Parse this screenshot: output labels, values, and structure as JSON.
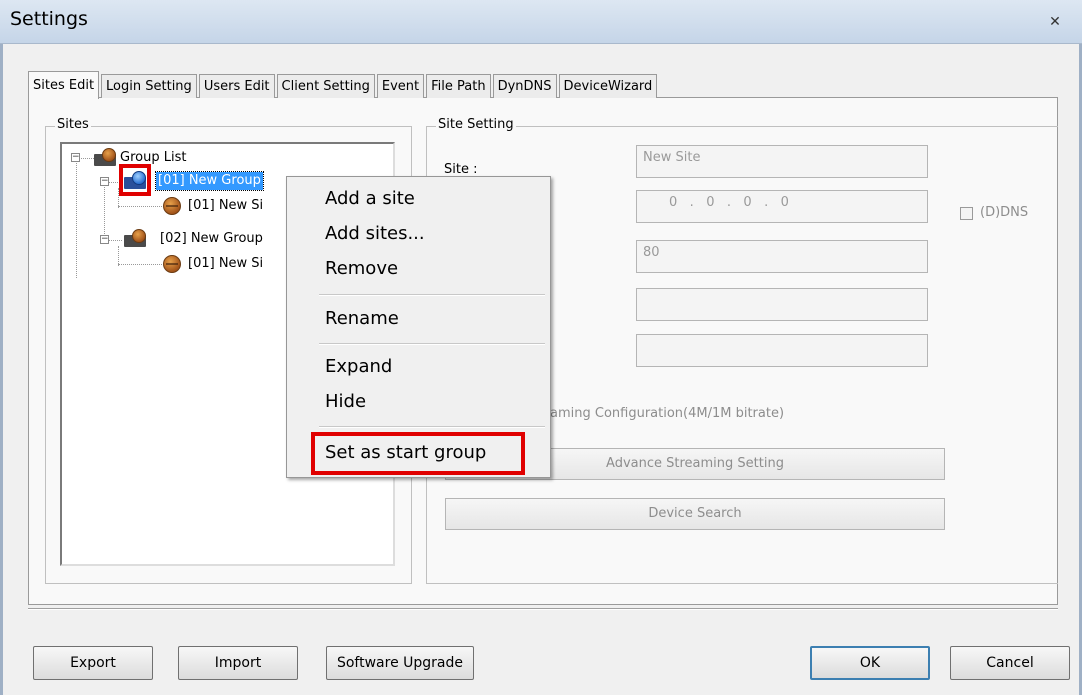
{
  "window": {
    "title": "Settings",
    "close_glyph": "✕"
  },
  "tabs": [
    "Sites Edit",
    "Login Setting",
    "Users Edit",
    "Client Setting",
    "Event",
    "File Path",
    "DynDNS",
    "DeviceWizard"
  ],
  "sites": {
    "label": "Sites",
    "tree": {
      "root": "Group List",
      "group1": "[01] New Group",
      "group1_site1": "[01] New Si",
      "group2": "[02] New Group",
      "group2_site1": "[01] New Si"
    }
  },
  "site_setting": {
    "label": "Site Setting",
    "site_label": "Site :",
    "site_value": "New Site",
    "ip_value": "0   .   0   .   0   .   0",
    "dns_label": "(D)DNS",
    "port_value": "80",
    "streaming_label": "aming Configuration(4M/1M bitrate)",
    "advance_button": "Advance Streaming Setting",
    "search_button": "Device Search"
  },
  "context_menu": {
    "add_site": "Add a site",
    "add_sites": "Add sites...",
    "remove": "Remove",
    "rename": "Rename",
    "expand": "Expand",
    "hide": "Hide",
    "set_start": "Set as start group"
  },
  "footer": {
    "export": "Export",
    "import": "Import",
    "upgrade": "Software Upgrade",
    "ok": "OK",
    "cancel": "Cancel"
  },
  "colors": {
    "highlight": "#e00000",
    "selection": "#3399ff"
  }
}
